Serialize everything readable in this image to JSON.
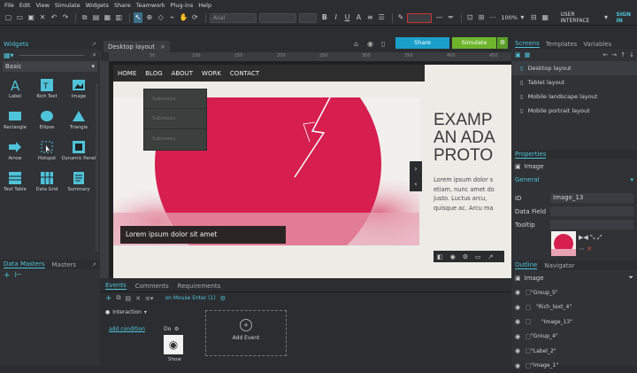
{
  "menu": [
    "File",
    "Edit",
    "View",
    "Simulate",
    "Widgets",
    "Share",
    "Teamwork",
    "Plug-ins",
    "Help"
  ],
  "toolbar": {
    "font_placeholder": "Arial",
    "zoom": "100%",
    "mode": "USER INTERFACE",
    "signin": "SIGN IN"
  },
  "widgets_panel": {
    "title": "Widgets",
    "category": "Basic",
    "items": [
      {
        "label": "Label",
        "icon": "label-icon"
      },
      {
        "label": "Rich Text",
        "icon": "rich-text-icon"
      },
      {
        "label": "Image",
        "icon": "image-icon"
      },
      {
        "label": "Line",
        "icon": "line-icon"
      },
      {
        "label": "Rectangle",
        "icon": "rectangle-icon"
      },
      {
        "label": "Ellipse",
        "icon": "ellipse-icon"
      },
      {
        "label": "Triangle",
        "icon": "triangle-icon"
      },
      {
        "label": "Callout",
        "icon": "callout-icon"
      },
      {
        "label": "Arrow",
        "icon": "arrow-icon"
      },
      {
        "label": "Hotspot",
        "icon": "hotspot-icon"
      },
      {
        "label": "Dynamic Panel",
        "icon": "dynamic-panel-icon"
      },
      {
        "label": "Table",
        "icon": "table-icon"
      },
      {
        "label": "Text Table",
        "icon": "text-table-icon"
      },
      {
        "label": "Data Grid",
        "icon": "data-grid-icon"
      },
      {
        "label": "Summary",
        "icon": "summary-icon"
      },
      {
        "label": "Index",
        "icon": "index-icon"
      }
    ]
  },
  "data_masters": {
    "tabs": [
      "Data Masters",
      "Masters"
    ]
  },
  "canvas": {
    "tab": "Desktop layout",
    "share": "Share",
    "simulate": "Simulate",
    "ruler_marks": [
      "50",
      "100",
      "150",
      "200",
      "250",
      "300",
      "350",
      "400",
      "450"
    ],
    "nav": [
      "HOME",
      "BLOG",
      "ABOUT",
      "WORK",
      "CONTACT"
    ],
    "submenu": [
      "Submenu",
      "Submenu",
      "Submenu"
    ],
    "hero_caption": "Lorem ipsum dolor sit amet",
    "heading": [
      "EXAMP",
      "AN ADA",
      "PROTO"
    ],
    "body_text": [
      "Lorem ipsum dolor s",
      "etiam, nunc amet do",
      "justo. Luctus arcu,",
      "quisque ac. Arcu ma"
    ]
  },
  "events": {
    "tabs": [
      "Events",
      "Comments",
      "Requirements"
    ],
    "event_name": "on Mouse Enter (1)",
    "interaction": "Interaction",
    "add_condition": "add condition",
    "do": "Do",
    "action": "Show",
    "add_event": "Add Event"
  },
  "screens": {
    "tabs": [
      "Screens",
      "Templates",
      "Variables"
    ],
    "items": [
      "Desktop layout",
      "Tablet layout",
      "Mobile landscape layout",
      "Mobile portrait layout"
    ]
  },
  "properties": {
    "title": "Properties",
    "widget": "Image",
    "section": "General",
    "fields": [
      {
        "label": "ID",
        "value": "Image_13"
      },
      {
        "label": "Data Field",
        "value": ""
      },
      {
        "label": "Tooltip",
        "value": ""
      }
    ]
  },
  "outline": {
    "tabs": [
      "Outline",
      "Navigator"
    ],
    "root": "Image",
    "items": [
      "\"Group_5\"",
      "\"Rich_text_4\"",
      "\"Image_13\"",
      "\"Group_4\"",
      "\"Label_2\"",
      "\"Image_1\""
    ]
  },
  "colors": {
    "accent": "#4fc3d9",
    "share": "#1a9fc9",
    "simulate": "#6fb52c",
    "hero": "#d61f4f"
  }
}
